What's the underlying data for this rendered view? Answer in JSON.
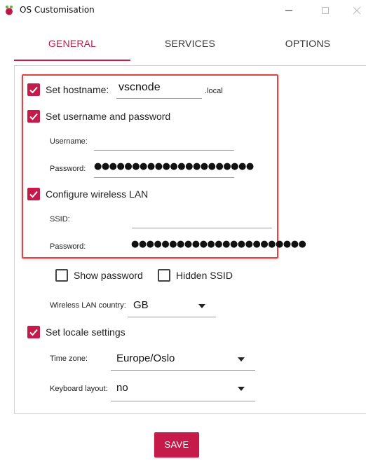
{
  "window": {
    "title": "OS Customisation"
  },
  "tabs": [
    {
      "label": "GENERAL",
      "active": true
    },
    {
      "label": "SERVICES",
      "active": false
    },
    {
      "label": "OPTIONS",
      "active": false
    }
  ],
  "general": {
    "hostname": {
      "label": "Set hostname:",
      "checked": true,
      "value": "vscnode",
      "suffix": ".local"
    },
    "user": {
      "label": "Set username and password",
      "checked": true,
      "username_label": "Username:",
      "username_value": "",
      "password_label": "Password:",
      "password_mask": "●●●●●●●●●●●●●●●●●●●●●"
    },
    "wifi": {
      "label": "Configure wireless LAN",
      "checked": true,
      "ssid_label": "SSID:",
      "ssid_value": "",
      "password_label": "Password:",
      "password_mask": "●●●●●●●●●●●●●●●●●●●●●●●",
      "show_password_label": "Show password",
      "show_password_checked": false,
      "hidden_ssid_label": "Hidden SSID",
      "hidden_ssid_checked": false,
      "country_label": "Wireless LAN country:",
      "country_value": "GB"
    },
    "locale": {
      "label": "Set locale settings",
      "checked": true,
      "timezone_label": "Time zone:",
      "timezone_value": "Europe/Oslo",
      "keyboard_label": "Keyboard layout:",
      "keyboard_value": "no"
    }
  },
  "actions": {
    "save_label": "SAVE"
  },
  "colors": {
    "accent": "#c51a4a",
    "highlight_border": "#e04545"
  }
}
